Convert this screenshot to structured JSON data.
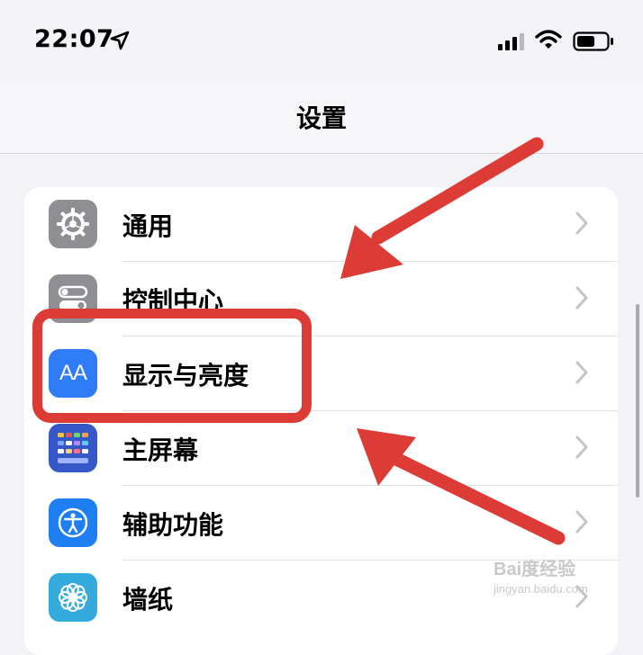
{
  "status_bar": {
    "time": "22:07",
    "location_icon": "location-arrow-icon",
    "signal_icon": "cellular-signal-icon",
    "wifi_icon": "wifi-icon",
    "battery_icon": "battery-icon"
  },
  "nav": {
    "title": "设置"
  },
  "settings_rows": [
    {
      "label": "通用",
      "icon": "gear-icon"
    },
    {
      "label": "控制中心",
      "icon": "toggle-switches-icon"
    },
    {
      "label": "显示与亮度",
      "icon": "text-size-aa-icon",
      "icon_text": "AA"
    },
    {
      "label": "主屏幕",
      "icon": "home-screen-grid-icon"
    },
    {
      "label": "辅助功能",
      "icon": "accessibility-icon"
    },
    {
      "label": "墙纸",
      "icon": "flower-wallpaper-icon"
    }
  ],
  "annotations": {
    "highlight_color": "#dd3b35",
    "highlighted_item": "显示与亮度"
  },
  "watermark": {
    "main": "Bai度经验",
    "sub": "jingyan.baidu.com"
  }
}
